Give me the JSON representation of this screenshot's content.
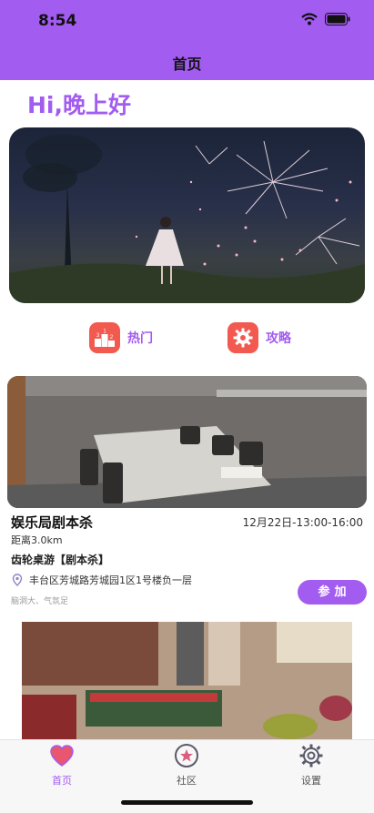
{
  "status_bar": {
    "time": "8:54"
  },
  "nav": {
    "title": "首页"
  },
  "greeting": "Hi,晚上好",
  "quick_actions": [
    {
      "label": "热门",
      "icon": "podium-icon"
    },
    {
      "label": "攻略",
      "icon": "gear-icon"
    }
  ],
  "venue": {
    "name": "娱乐局剧本杀",
    "time": "12月22日-13:00-16:00",
    "distance": "距离3.0km",
    "category": "齿轮桌游【剧本杀】",
    "address": "丰台区芳城路芳城园1区1号楼负一层",
    "tags": "脑洞大、气氛足",
    "join_label": "参加"
  },
  "tabbar": [
    {
      "label": "首页",
      "icon": "heart-icon",
      "active": true
    },
    {
      "label": "社区",
      "icon": "star-badge-icon",
      "active": false
    },
    {
      "label": "设置",
      "icon": "settings-gear-icon",
      "active": false
    }
  ],
  "colors": {
    "accent": "#a35cf0",
    "icon_red": "#f25a50",
    "tab_active": "#a35cf0",
    "tab_inactive": "#555555"
  }
}
